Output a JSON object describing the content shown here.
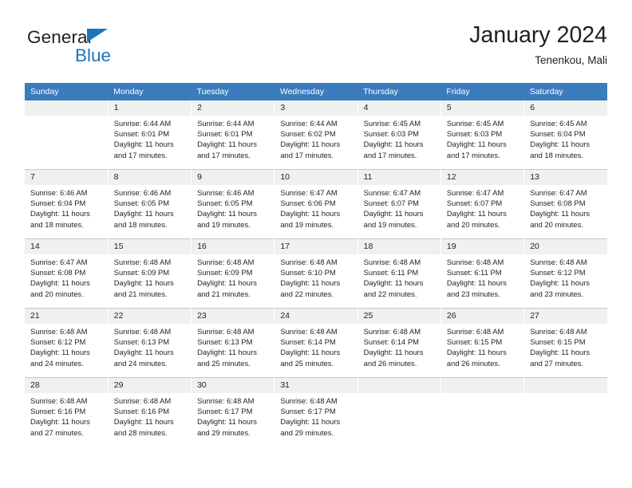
{
  "logo": {
    "word_top": "General",
    "word_bottom": "Blue",
    "triangle_color": "#1b75bb",
    "top_color": "#231f20"
  },
  "header": {
    "title": "January 2024",
    "location": "Tenenkou, Mali"
  },
  "calendar": {
    "header_bg": "#3a7cbe",
    "daynum_bg": "#f0f0f0",
    "weekdays": [
      "Sunday",
      "Monday",
      "Tuesday",
      "Wednesday",
      "Thursday",
      "Friday",
      "Saturday"
    ],
    "weeks": [
      [
        {
          "day": "",
          "sunrise": "",
          "sunset": "",
          "daylight1": "",
          "daylight2": ""
        },
        {
          "day": "1",
          "sunrise": "Sunrise: 6:44 AM",
          "sunset": "Sunset: 6:01 PM",
          "daylight1": "Daylight: 11 hours",
          "daylight2": "and 17 minutes."
        },
        {
          "day": "2",
          "sunrise": "Sunrise: 6:44 AM",
          "sunset": "Sunset: 6:01 PM",
          "daylight1": "Daylight: 11 hours",
          "daylight2": "and 17 minutes."
        },
        {
          "day": "3",
          "sunrise": "Sunrise: 6:44 AM",
          "sunset": "Sunset: 6:02 PM",
          "daylight1": "Daylight: 11 hours",
          "daylight2": "and 17 minutes."
        },
        {
          "day": "4",
          "sunrise": "Sunrise: 6:45 AM",
          "sunset": "Sunset: 6:03 PM",
          "daylight1": "Daylight: 11 hours",
          "daylight2": "and 17 minutes."
        },
        {
          "day": "5",
          "sunrise": "Sunrise: 6:45 AM",
          "sunset": "Sunset: 6:03 PM",
          "daylight1": "Daylight: 11 hours",
          "daylight2": "and 17 minutes."
        },
        {
          "day": "6",
          "sunrise": "Sunrise: 6:45 AM",
          "sunset": "Sunset: 6:04 PM",
          "daylight1": "Daylight: 11 hours",
          "daylight2": "and 18 minutes."
        }
      ],
      [
        {
          "day": "7",
          "sunrise": "Sunrise: 6:46 AM",
          "sunset": "Sunset: 6:04 PM",
          "daylight1": "Daylight: 11 hours",
          "daylight2": "and 18 minutes."
        },
        {
          "day": "8",
          "sunrise": "Sunrise: 6:46 AM",
          "sunset": "Sunset: 6:05 PM",
          "daylight1": "Daylight: 11 hours",
          "daylight2": "and 18 minutes."
        },
        {
          "day": "9",
          "sunrise": "Sunrise: 6:46 AM",
          "sunset": "Sunset: 6:05 PM",
          "daylight1": "Daylight: 11 hours",
          "daylight2": "and 19 minutes."
        },
        {
          "day": "10",
          "sunrise": "Sunrise: 6:47 AM",
          "sunset": "Sunset: 6:06 PM",
          "daylight1": "Daylight: 11 hours",
          "daylight2": "and 19 minutes."
        },
        {
          "day": "11",
          "sunrise": "Sunrise: 6:47 AM",
          "sunset": "Sunset: 6:07 PM",
          "daylight1": "Daylight: 11 hours",
          "daylight2": "and 19 minutes."
        },
        {
          "day": "12",
          "sunrise": "Sunrise: 6:47 AM",
          "sunset": "Sunset: 6:07 PM",
          "daylight1": "Daylight: 11 hours",
          "daylight2": "and 20 minutes."
        },
        {
          "day": "13",
          "sunrise": "Sunrise: 6:47 AM",
          "sunset": "Sunset: 6:08 PM",
          "daylight1": "Daylight: 11 hours",
          "daylight2": "and 20 minutes."
        }
      ],
      [
        {
          "day": "14",
          "sunrise": "Sunrise: 6:47 AM",
          "sunset": "Sunset: 6:08 PM",
          "daylight1": "Daylight: 11 hours",
          "daylight2": "and 20 minutes."
        },
        {
          "day": "15",
          "sunrise": "Sunrise: 6:48 AM",
          "sunset": "Sunset: 6:09 PM",
          "daylight1": "Daylight: 11 hours",
          "daylight2": "and 21 minutes."
        },
        {
          "day": "16",
          "sunrise": "Sunrise: 6:48 AM",
          "sunset": "Sunset: 6:09 PM",
          "daylight1": "Daylight: 11 hours",
          "daylight2": "and 21 minutes."
        },
        {
          "day": "17",
          "sunrise": "Sunrise: 6:48 AM",
          "sunset": "Sunset: 6:10 PM",
          "daylight1": "Daylight: 11 hours",
          "daylight2": "and 22 minutes."
        },
        {
          "day": "18",
          "sunrise": "Sunrise: 6:48 AM",
          "sunset": "Sunset: 6:11 PM",
          "daylight1": "Daylight: 11 hours",
          "daylight2": "and 22 minutes."
        },
        {
          "day": "19",
          "sunrise": "Sunrise: 6:48 AM",
          "sunset": "Sunset: 6:11 PM",
          "daylight1": "Daylight: 11 hours",
          "daylight2": "and 23 minutes."
        },
        {
          "day": "20",
          "sunrise": "Sunrise: 6:48 AM",
          "sunset": "Sunset: 6:12 PM",
          "daylight1": "Daylight: 11 hours",
          "daylight2": "and 23 minutes."
        }
      ],
      [
        {
          "day": "21",
          "sunrise": "Sunrise: 6:48 AM",
          "sunset": "Sunset: 6:12 PM",
          "daylight1": "Daylight: 11 hours",
          "daylight2": "and 24 minutes."
        },
        {
          "day": "22",
          "sunrise": "Sunrise: 6:48 AM",
          "sunset": "Sunset: 6:13 PM",
          "daylight1": "Daylight: 11 hours",
          "daylight2": "and 24 minutes."
        },
        {
          "day": "23",
          "sunrise": "Sunrise: 6:48 AM",
          "sunset": "Sunset: 6:13 PM",
          "daylight1": "Daylight: 11 hours",
          "daylight2": "and 25 minutes."
        },
        {
          "day": "24",
          "sunrise": "Sunrise: 6:48 AM",
          "sunset": "Sunset: 6:14 PM",
          "daylight1": "Daylight: 11 hours",
          "daylight2": "and 25 minutes."
        },
        {
          "day": "25",
          "sunrise": "Sunrise: 6:48 AM",
          "sunset": "Sunset: 6:14 PM",
          "daylight1": "Daylight: 11 hours",
          "daylight2": "and 26 minutes."
        },
        {
          "day": "26",
          "sunrise": "Sunrise: 6:48 AM",
          "sunset": "Sunset: 6:15 PM",
          "daylight1": "Daylight: 11 hours",
          "daylight2": "and 26 minutes."
        },
        {
          "day": "27",
          "sunrise": "Sunrise: 6:48 AM",
          "sunset": "Sunset: 6:15 PM",
          "daylight1": "Daylight: 11 hours",
          "daylight2": "and 27 minutes."
        }
      ],
      [
        {
          "day": "28",
          "sunrise": "Sunrise: 6:48 AM",
          "sunset": "Sunset: 6:16 PM",
          "daylight1": "Daylight: 11 hours",
          "daylight2": "and 27 minutes."
        },
        {
          "day": "29",
          "sunrise": "Sunrise: 6:48 AM",
          "sunset": "Sunset: 6:16 PM",
          "daylight1": "Daylight: 11 hours",
          "daylight2": "and 28 minutes."
        },
        {
          "day": "30",
          "sunrise": "Sunrise: 6:48 AM",
          "sunset": "Sunset: 6:17 PM",
          "daylight1": "Daylight: 11 hours",
          "daylight2": "and 29 minutes."
        },
        {
          "day": "31",
          "sunrise": "Sunrise: 6:48 AM",
          "sunset": "Sunset: 6:17 PM",
          "daylight1": "Daylight: 11 hours",
          "daylight2": "and 29 minutes."
        },
        {
          "day": "",
          "sunrise": "",
          "sunset": "",
          "daylight1": "",
          "daylight2": ""
        },
        {
          "day": "",
          "sunrise": "",
          "sunset": "",
          "daylight1": "",
          "daylight2": ""
        },
        {
          "day": "",
          "sunrise": "",
          "sunset": "",
          "daylight1": "",
          "daylight2": ""
        }
      ]
    ]
  }
}
